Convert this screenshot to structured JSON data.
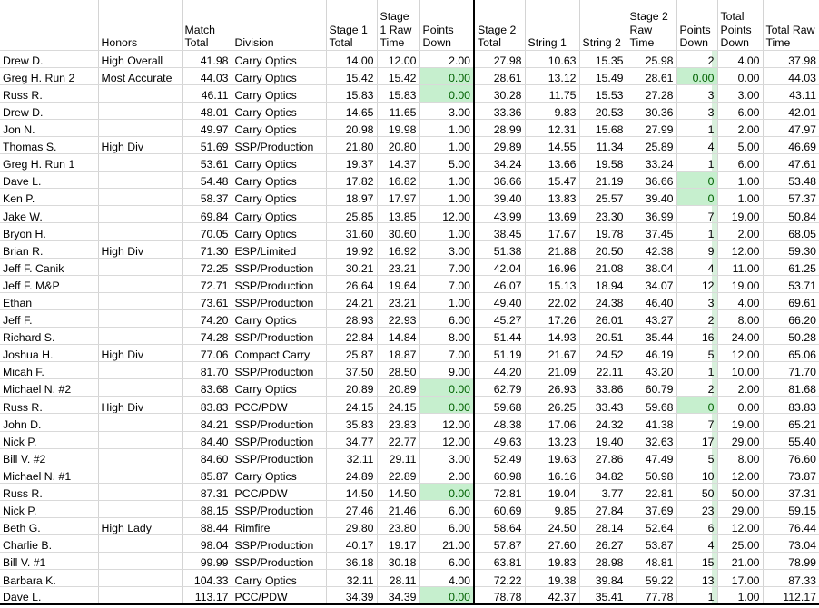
{
  "table": {
    "columns": [
      {
        "key": "name",
        "label": "",
        "type": "text"
      },
      {
        "key": "honors",
        "label": "Honors",
        "type": "text"
      },
      {
        "key": "match_total",
        "label": "Match Total",
        "type": "num"
      },
      {
        "key": "division",
        "label": "Division",
        "type": "text"
      },
      {
        "key": "s1_total",
        "label": "Stage 1 Total",
        "type": "num"
      },
      {
        "key": "s1_raw",
        "label": "Stage 1 Raw Time",
        "type": "num"
      },
      {
        "key": "s1_down",
        "label": "Points Down",
        "type": "num"
      },
      {
        "key": "s2_total",
        "label": "Stage 2 Total",
        "type": "num"
      },
      {
        "key": "string1",
        "label": "String 1",
        "type": "num"
      },
      {
        "key": "string2",
        "label": "String 2",
        "type": "num"
      },
      {
        "key": "s2_raw",
        "label": "Stage 2 Raw Time",
        "type": "num"
      },
      {
        "key": "s2_down",
        "label": "Points Down",
        "type": "num"
      },
      {
        "key": "tot_down",
        "label": "Total Points Down",
        "type": "num"
      },
      {
        "key": "tot_raw",
        "label": "Total Raw Time",
        "type": "num"
      }
    ],
    "highlight": {
      "background": "#C6EFCE",
      "text": "#006100"
    },
    "rows": [
      {
        "name": "Drew D.",
        "honors": "High Overall",
        "match_total": "41.98",
        "division": "Carry Optics",
        "s1_total": "14.00",
        "s1_raw": "12.00",
        "s1_down": "2.00",
        "s2_total": "27.98",
        "string1": "10.63",
        "string2": "15.35",
        "s2_raw": "25.98",
        "s2_down": "2",
        "tot_down": "4.00",
        "tot_raw": "37.98"
      },
      {
        "name": "Greg H. Run 2",
        "honors": "Most Accurate",
        "match_total": "44.03",
        "division": "Carry Optics",
        "s1_total": "15.42",
        "s1_raw": "15.42",
        "s1_down": "0.00",
        "s2_total": "28.61",
        "string1": "13.12",
        "string2": "15.49",
        "s2_raw": "28.61",
        "s2_down": "0.00",
        "tot_down": "0.00",
        "tot_raw": "44.03"
      },
      {
        "name": "Russ R.",
        "honors": "",
        "match_total": "46.11",
        "division": "Carry Optics",
        "s1_total": "15.83",
        "s1_raw": "15.83",
        "s1_down": "0.00",
        "s2_total": "30.28",
        "string1": "11.75",
        "string2": "15.53",
        "s2_raw": "27.28",
        "s2_down": "3",
        "tot_down": "3.00",
        "tot_raw": "43.11"
      },
      {
        "name": "Drew D.",
        "honors": "",
        "match_total": "48.01",
        "division": "Carry Optics",
        "s1_total": "14.65",
        "s1_raw": "11.65",
        "s1_down": "3.00",
        "s2_total": "33.36",
        "string1": "9.83",
        "string2": "20.53",
        "s2_raw": "30.36",
        "s2_down": "3",
        "tot_down": "6.00",
        "tot_raw": "42.01"
      },
      {
        "name": "Jon N.",
        "honors": "",
        "match_total": "49.97",
        "division": "Carry Optics",
        "s1_total": "20.98",
        "s1_raw": "19.98",
        "s1_down": "1.00",
        "s2_total": "28.99",
        "string1": "12.31",
        "string2": "15.68",
        "s2_raw": "27.99",
        "s2_down": "1",
        "tot_down": "2.00",
        "tot_raw": "47.97"
      },
      {
        "name": "Thomas S.",
        "honors": "High Div",
        "match_total": "51.69",
        "division": "SSP/Production",
        "s1_total": "21.80",
        "s1_raw": "20.80",
        "s1_down": "1.00",
        "s2_total": "29.89",
        "string1": "14.55",
        "string2": "11.34",
        "s2_raw": "25.89",
        "s2_down": "4",
        "tot_down": "5.00",
        "tot_raw": "46.69"
      },
      {
        "name": "Greg H. Run 1",
        "honors": "",
        "match_total": "53.61",
        "division": "Carry Optics",
        "s1_total": "19.37",
        "s1_raw": "14.37",
        "s1_down": "5.00",
        "s2_total": "34.24",
        "string1": "13.66",
        "string2": "19.58",
        "s2_raw": "33.24",
        "s2_down": "1",
        "tot_down": "6.00",
        "tot_raw": "47.61"
      },
      {
        "name": "Dave L.",
        "honors": "",
        "match_total": "54.48",
        "division": "Carry Optics",
        "s1_total": "17.82",
        "s1_raw": "16.82",
        "s1_down": "1.00",
        "s2_total": "36.66",
        "string1": "15.47",
        "string2": "21.19",
        "s2_raw": "36.66",
        "s2_down": "0",
        "tot_down": "1.00",
        "tot_raw": "53.48"
      },
      {
        "name": "Ken P.",
        "honors": "",
        "match_total": "58.37",
        "division": "Carry Optics",
        "s1_total": "18.97",
        "s1_raw": "17.97",
        "s1_down": "1.00",
        "s2_total": "39.40",
        "string1": "13.83",
        "string2": "25.57",
        "s2_raw": "39.40",
        "s2_down": "0",
        "tot_down": "1.00",
        "tot_raw": "57.37"
      },
      {
        "name": "Jake W.",
        "honors": "",
        "match_total": "69.84",
        "division": "Carry Optics",
        "s1_total": "25.85",
        "s1_raw": "13.85",
        "s1_down": "12.00",
        "s2_total": "43.99",
        "string1": "13.69",
        "string2": "23.30",
        "s2_raw": "36.99",
        "s2_down": "7",
        "tot_down": "19.00",
        "tot_raw": "50.84"
      },
      {
        "name": "Bryon H.",
        "honors": "",
        "match_total": "70.05",
        "division": "Carry Optics",
        "s1_total": "31.60",
        "s1_raw": "30.60",
        "s1_down": "1.00",
        "s2_total": "38.45",
        "string1": "17.67",
        "string2": "19.78",
        "s2_raw": "37.45",
        "s2_down": "1",
        "tot_down": "2.00",
        "tot_raw": "68.05"
      },
      {
        "name": "Brian R.",
        "honors": "High Div",
        "match_total": "71.30",
        "division": "ESP/Limited",
        "s1_total": "19.92",
        "s1_raw": "16.92",
        "s1_down": "3.00",
        "s2_total": "51.38",
        "string1": "21.88",
        "string2": "20.50",
        "s2_raw": "42.38",
        "s2_down": "9",
        "tot_down": "12.00",
        "tot_raw": "59.30"
      },
      {
        "name": "Jeff F. Canik",
        "honors": "",
        "match_total": "72.25",
        "division": "SSP/Production",
        "s1_total": "30.21",
        "s1_raw": "23.21",
        "s1_down": "7.00",
        "s2_total": "42.04",
        "string1": "16.96",
        "string2": "21.08",
        "s2_raw": "38.04",
        "s2_down": "4",
        "tot_down": "11.00",
        "tot_raw": "61.25"
      },
      {
        "name": "Jeff F. M&P",
        "honors": "",
        "match_total": "72.71",
        "division": "SSP/Production",
        "s1_total": "26.64",
        "s1_raw": "19.64",
        "s1_down": "7.00",
        "s2_total": "46.07",
        "string1": "15.13",
        "string2": "18.94",
        "s2_raw": "34.07",
        "s2_down": "12",
        "tot_down": "19.00",
        "tot_raw": "53.71"
      },
      {
        "name": "Ethan",
        "honors": "",
        "match_total": "73.61",
        "division": "SSP/Production",
        "s1_total": "24.21",
        "s1_raw": "23.21",
        "s1_down": "1.00",
        "s2_total": "49.40",
        "string1": "22.02",
        "string2": "24.38",
        "s2_raw": "46.40",
        "s2_down": "3",
        "tot_down": "4.00",
        "tot_raw": "69.61"
      },
      {
        "name": "Jeff F.",
        "honors": "",
        "match_total": "74.20",
        "division": "Carry Optics",
        "s1_total": "28.93",
        "s1_raw": "22.93",
        "s1_down": "6.00",
        "s2_total": "45.27",
        "string1": "17.26",
        "string2": "26.01",
        "s2_raw": "43.27",
        "s2_down": "2",
        "tot_down": "8.00",
        "tot_raw": "66.20"
      },
      {
        "name": "Richard S.",
        "honors": "",
        "match_total": "74.28",
        "division": "SSP/Production",
        "s1_total": "22.84",
        "s1_raw": "14.84",
        "s1_down": "8.00",
        "s2_total": "51.44",
        "string1": "14.93",
        "string2": "20.51",
        "s2_raw": "35.44",
        "s2_down": "16",
        "tot_down": "24.00",
        "tot_raw": "50.28"
      },
      {
        "name": "Joshua H.",
        "honors": "High Div",
        "match_total": "77.06",
        "division": "Compact Carry",
        "s1_total": "25.87",
        "s1_raw": "18.87",
        "s1_down": "7.00",
        "s2_total": "51.19",
        "string1": "21.67",
        "string2": "24.52",
        "s2_raw": "46.19",
        "s2_down": "5",
        "tot_down": "12.00",
        "tot_raw": "65.06"
      },
      {
        "name": "Micah F.",
        "honors": "",
        "match_total": "81.70",
        "division": "SSP/Production",
        "s1_total": "37.50",
        "s1_raw": "28.50",
        "s1_down": "9.00",
        "s2_total": "44.20",
        "string1": "21.09",
        "string2": "22.11",
        "s2_raw": "43.20",
        "s2_down": "1",
        "tot_down": "10.00",
        "tot_raw": "71.70"
      },
      {
        "name": "Michael N. #2",
        "honors": "",
        "match_total": "83.68",
        "division": "Carry Optics",
        "s1_total": "20.89",
        "s1_raw": "20.89",
        "s1_down": "0.00",
        "s2_total": "62.79",
        "string1": "26.93",
        "string2": "33.86",
        "s2_raw": "60.79",
        "s2_down": "2",
        "tot_down": "2.00",
        "tot_raw": "81.68"
      },
      {
        "name": "Russ R.",
        "honors": "High Div",
        "match_total": "83.83",
        "division": "PCC/PDW",
        "s1_total": "24.15",
        "s1_raw": "24.15",
        "s1_down": "0.00",
        "s2_total": "59.68",
        "string1": "26.25",
        "string2": "33.43",
        "s2_raw": "59.68",
        "s2_down": "0",
        "tot_down": "0.00",
        "tot_raw": "83.83"
      },
      {
        "name": "John D.",
        "honors": "",
        "match_total": "84.21",
        "division": "SSP/Production",
        "s1_total": "35.83",
        "s1_raw": "23.83",
        "s1_down": "12.00",
        "s2_total": "48.38",
        "string1": "17.06",
        "string2": "24.32",
        "s2_raw": "41.38",
        "s2_down": "7",
        "tot_down": "19.00",
        "tot_raw": "65.21"
      },
      {
        "name": "Nick P.",
        "honors": "",
        "match_total": "84.40",
        "division": "SSP/Production",
        "s1_total": "34.77",
        "s1_raw": "22.77",
        "s1_down": "12.00",
        "s2_total": "49.63",
        "string1": "13.23",
        "string2": "19.40",
        "s2_raw": "32.63",
        "s2_down": "17",
        "tot_down": "29.00",
        "tot_raw": "55.40"
      },
      {
        "name": "Bill V. #2",
        "honors": "",
        "match_total": "84.60",
        "division": "SSP/Production",
        "s1_total": "32.11",
        "s1_raw": "29.11",
        "s1_down": "3.00",
        "s2_total": "52.49",
        "string1": "19.63",
        "string2": "27.86",
        "s2_raw": "47.49",
        "s2_down": "5",
        "tot_down": "8.00",
        "tot_raw": "76.60"
      },
      {
        "name": "Michael N. #1",
        "honors": "",
        "match_total": "85.87",
        "division": "Carry Optics",
        "s1_total": "24.89",
        "s1_raw": "22.89",
        "s1_down": "2.00",
        "s2_total": "60.98",
        "string1": "16.16",
        "string2": "34.82",
        "s2_raw": "50.98",
        "s2_down": "10",
        "tot_down": "12.00",
        "tot_raw": "73.87"
      },
      {
        "name": "Russ R.",
        "honors": "",
        "match_total": "87.31",
        "division": "PCC/PDW",
        "s1_total": "14.50",
        "s1_raw": "14.50",
        "s1_down": "0.00",
        "s2_total": "72.81",
        "string1": "19.04",
        "string2": "3.77",
        "s2_raw": "22.81",
        "s2_down": "50",
        "tot_down": "50.00",
        "tot_raw": "37.31"
      },
      {
        "name": "Nick P.",
        "honors": "",
        "match_total": "88.15",
        "division": "SSP/Production",
        "s1_total": "27.46",
        "s1_raw": "21.46",
        "s1_down": "6.00",
        "s2_total": "60.69",
        "string1": "9.85",
        "string2": "27.84",
        "s2_raw": "37.69",
        "s2_down": "23",
        "tot_down": "29.00",
        "tot_raw": "59.15"
      },
      {
        "name": "Beth G.",
        "honors": "High Lady",
        "match_total": "88.44",
        "division": "Rimfire",
        "s1_total": "29.80",
        "s1_raw": "23.80",
        "s1_down": "6.00",
        "s2_total": "58.64",
        "string1": "24.50",
        "string2": "28.14",
        "s2_raw": "52.64",
        "s2_down": "6",
        "tot_down": "12.00",
        "tot_raw": "76.44"
      },
      {
        "name": "Charlie B.",
        "honors": "",
        "match_total": "98.04",
        "division": "SSP/Production",
        "s1_total": "40.17",
        "s1_raw": "19.17",
        "s1_down": "21.00",
        "s2_total": "57.87",
        "string1": "27.60",
        "string2": "26.27",
        "s2_raw": "53.87",
        "s2_down": "4",
        "tot_down": "25.00",
        "tot_raw": "73.04"
      },
      {
        "name": "Bill V. #1",
        "honors": "",
        "match_total": "99.99",
        "division": "SSP/Production",
        "s1_total": "36.18",
        "s1_raw": "30.18",
        "s1_down": "6.00",
        "s2_total": "63.81",
        "string1": "19.83",
        "string2": "28.98",
        "s2_raw": "48.81",
        "s2_down": "15",
        "tot_down": "21.00",
        "tot_raw": "78.99"
      },
      {
        "name": "Barbara K.",
        "honors": "",
        "match_total": "104.33",
        "division": "Carry Optics",
        "s1_total": "32.11",
        "s1_raw": "28.11",
        "s1_down": "4.00",
        "s2_total": "72.22",
        "string1": "19.38",
        "string2": "39.84",
        "s2_raw": "59.22",
        "s2_down": "13",
        "tot_down": "17.00",
        "tot_raw": "87.33"
      },
      {
        "name": "Dave L.",
        "honors": "",
        "match_total": "113.17",
        "division": "PCC/PDW",
        "s1_total": "34.39",
        "s1_raw": "34.39",
        "s1_down": "0.00",
        "s2_total": "78.78",
        "string1": "42.37",
        "string2": "35.41",
        "s2_raw": "77.78",
        "s2_down": "1",
        "tot_down": "1.00",
        "tot_raw": "112.17"
      }
    ]
  }
}
